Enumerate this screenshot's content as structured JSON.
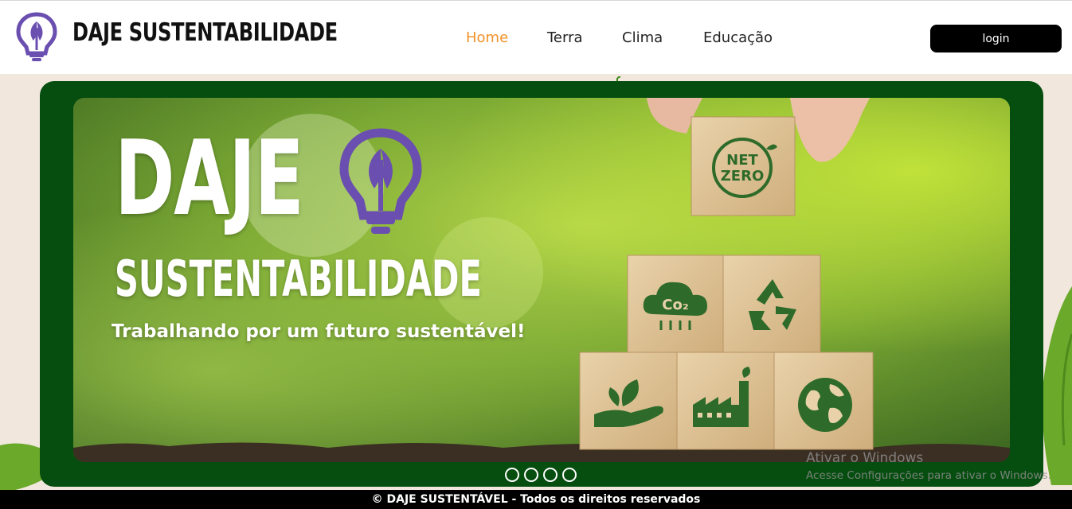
{
  "header": {
    "brand": "DAJE SUSTENTABILIDADE",
    "nav": [
      {
        "label": "Home",
        "active": true
      },
      {
        "label": "Terra",
        "active": false
      },
      {
        "label": "Clima",
        "active": false
      },
      {
        "label": "Educação",
        "active": false
      }
    ],
    "login_label": "login"
  },
  "hero": {
    "title": "DAJE",
    "subtitle": "SUSTENTABILIDADE",
    "tagline": "Trabalhando por um futuro sustentável!",
    "block_texts": {
      "net_zero_line1": "NET",
      "net_zero_line2": "ZERO",
      "co2": "Co₂"
    },
    "carousel_count": 4
  },
  "watermark": {
    "line1": "Ativar o Windows",
    "line2": "Acesse Configurações para ativar o Windows."
  },
  "footer": {
    "text": "© DAJE SUSTENTÁVEL - Todos os direitos reservados"
  },
  "colors": {
    "accent": "#f2922a",
    "frame_green": "#064d10",
    "logo_purple": "#6a4fb0",
    "page_bg": "#f1e7dc"
  },
  "icons": [
    "bulb-leaf-logo-icon",
    "net-zero-icon",
    "co2-cloud-icon",
    "recycle-icon",
    "hand-leaf-icon",
    "factory-icon",
    "globe-icon"
  ]
}
